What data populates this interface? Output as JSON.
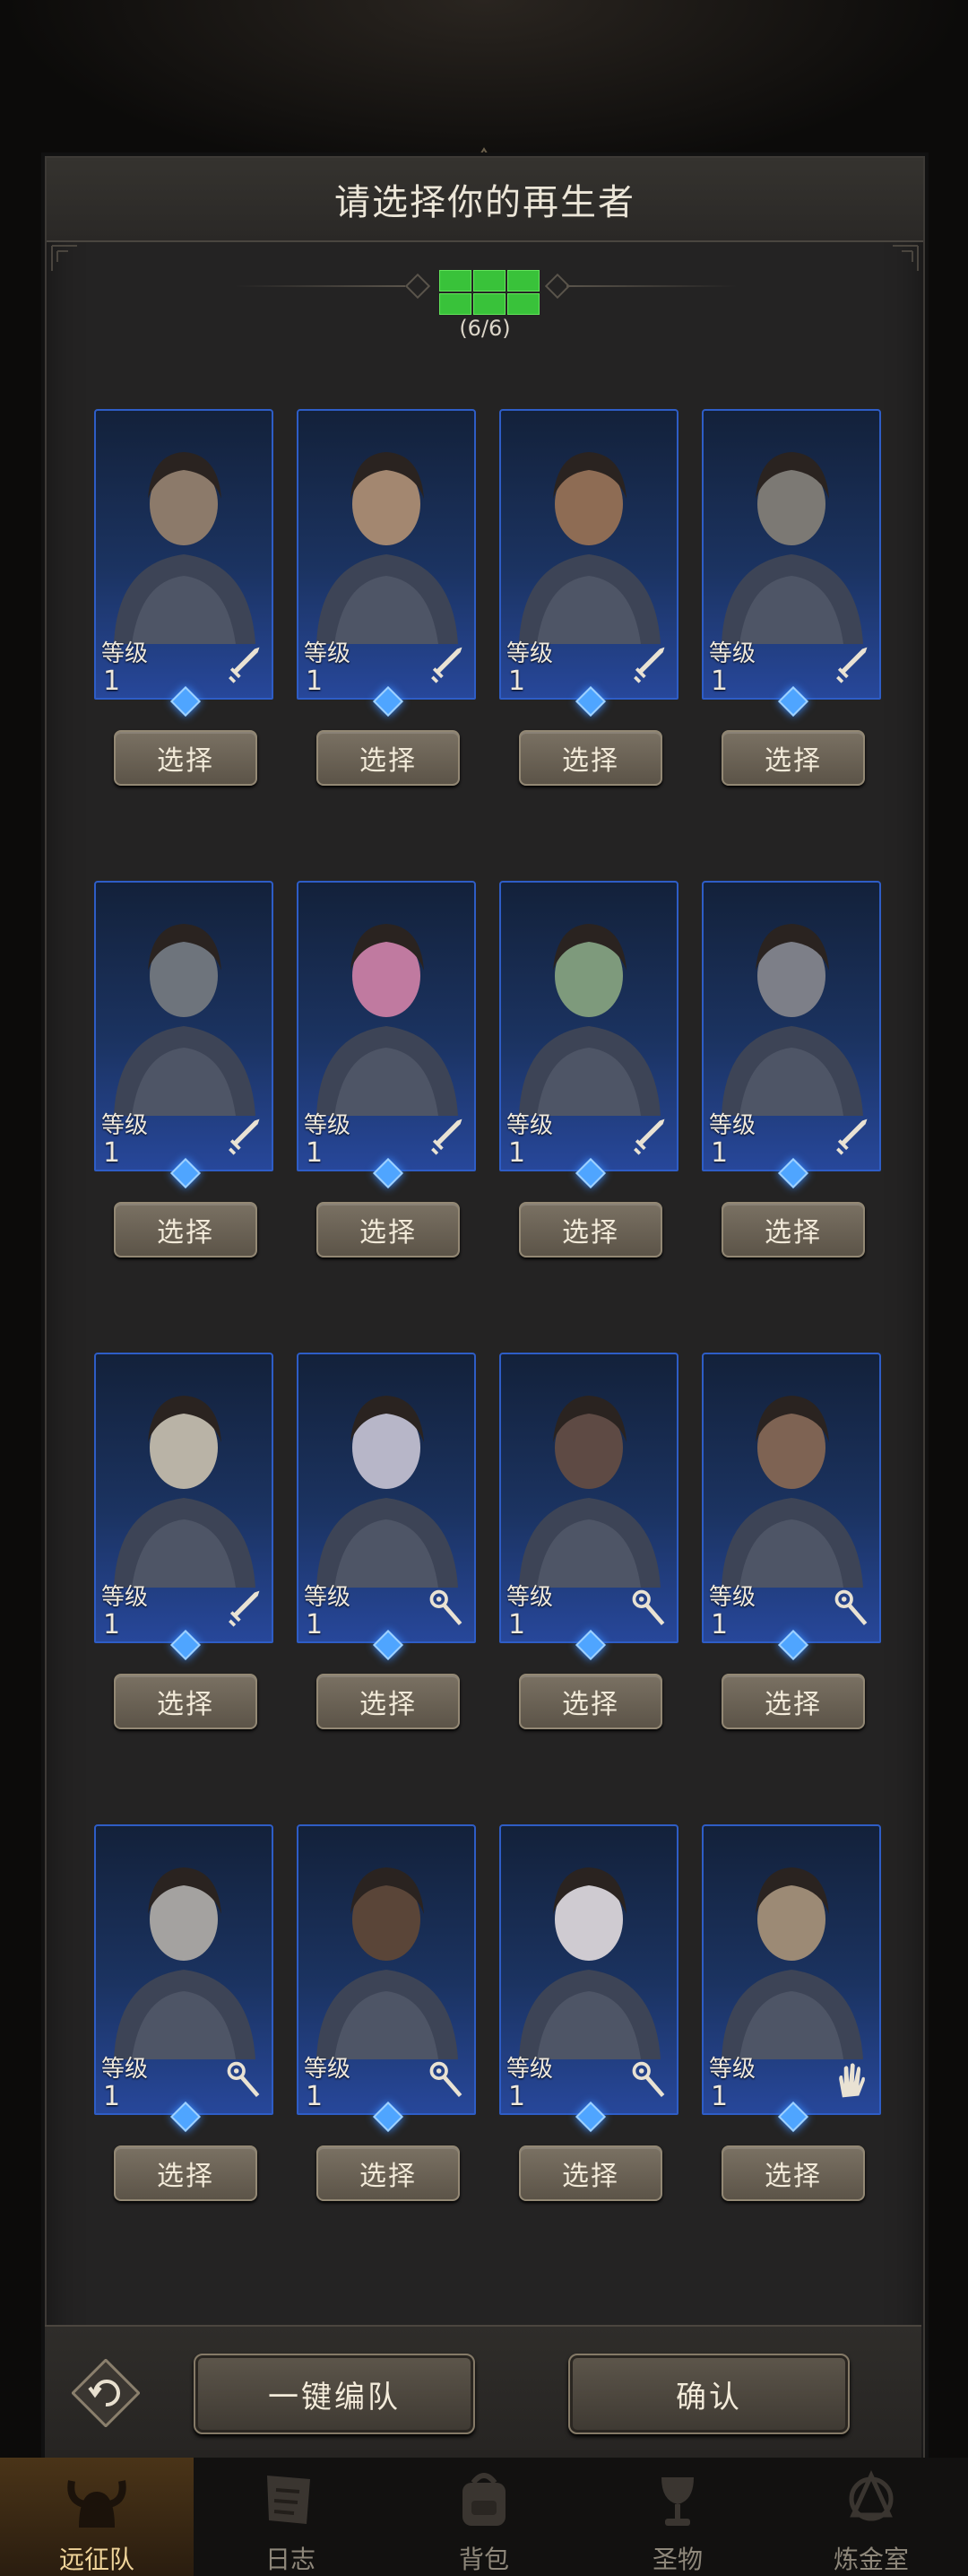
{
  "panel": {
    "title": "请选择你的再生者",
    "capacity_text": "(6/6)",
    "capacity_filled": 6,
    "capacity_total": 6
  },
  "level_label": "等级",
  "select_label": "选择",
  "heroes": [
    {
      "level": "1",
      "class_icon": "sword-icon"
    },
    {
      "level": "1",
      "class_icon": "sword-icon"
    },
    {
      "level": "1",
      "class_icon": "sword-icon"
    },
    {
      "level": "1",
      "class_icon": "sword-icon"
    },
    {
      "level": "1",
      "class_icon": "sword-icon"
    },
    {
      "level": "1",
      "class_icon": "sword-icon"
    },
    {
      "level": "1",
      "class_icon": "sword-icon"
    },
    {
      "level": "1",
      "class_icon": "sword-icon"
    },
    {
      "level": "1",
      "class_icon": "sword-icon"
    },
    {
      "level": "1",
      "class_icon": "staff-icon"
    },
    {
      "level": "1",
      "class_icon": "staff-icon"
    },
    {
      "level": "1",
      "class_icon": "staff-icon"
    },
    {
      "level": "1",
      "class_icon": "staff-icon"
    },
    {
      "level": "1",
      "class_icon": "staff-icon"
    },
    {
      "level": "1",
      "class_icon": "staff-icon"
    },
    {
      "level": "1",
      "class_icon": "hand-icon"
    }
  ],
  "footer": {
    "auto_team_label": "一键编队",
    "confirm_label": "确认"
  },
  "bottom_nav": [
    {
      "label": "远征队",
      "icon": "horned-helmet-icon",
      "active": true
    },
    {
      "label": "日志",
      "icon": "journal-icon",
      "active": false
    },
    {
      "label": "背包",
      "icon": "backpack-icon",
      "active": false
    },
    {
      "label": "圣物",
      "icon": "chalice-icon",
      "active": false
    },
    {
      "label": "炼金室",
      "icon": "alchemy-icon",
      "active": false
    }
  ],
  "colors": {
    "accent_green": "#39c23a",
    "card_border_blue": "#2e5dc6",
    "nav_active_gold": "#f0d49a"
  }
}
